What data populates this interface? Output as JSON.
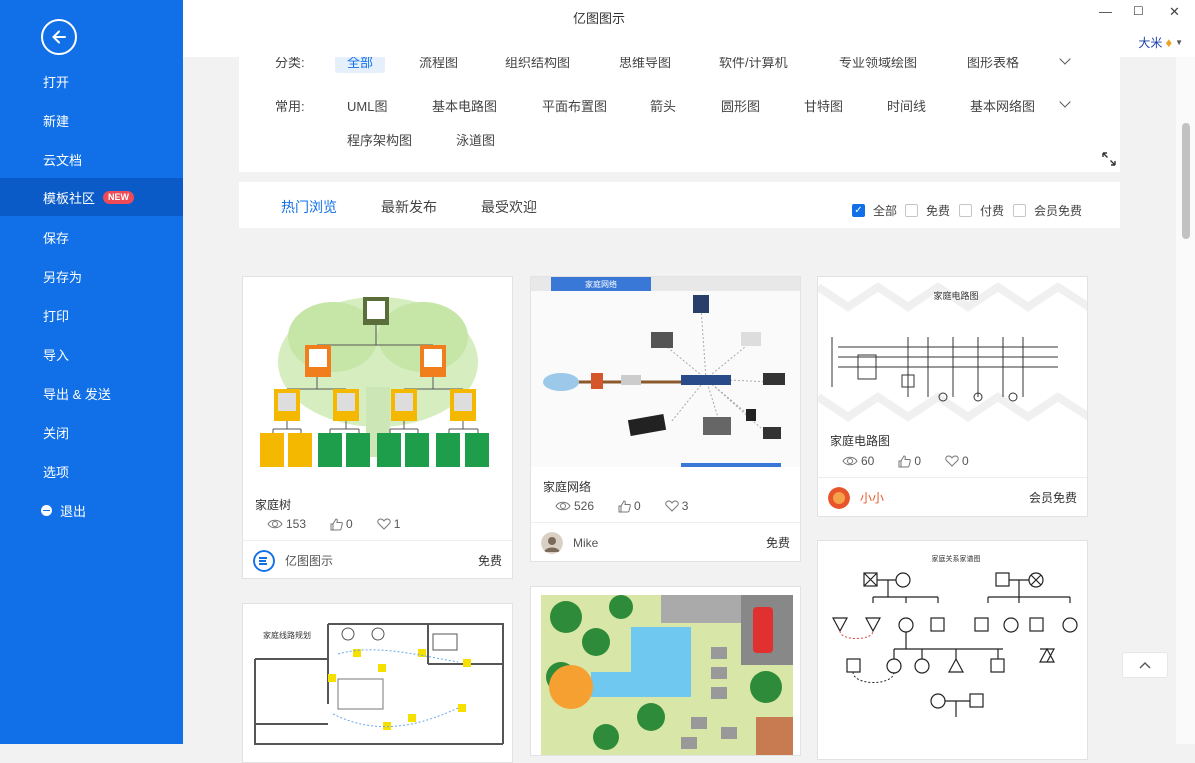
{
  "window": {
    "title": "亿图图示",
    "user": "大米",
    "minimize": "—",
    "maximize": "☐",
    "close": "✕"
  },
  "sidebar": {
    "items": [
      {
        "label": "打开"
      },
      {
        "label": "新建"
      },
      {
        "label": "云文档"
      },
      {
        "label": "模板社区",
        "badge": "NEW"
      },
      {
        "label": "保存"
      },
      {
        "label": "另存为"
      },
      {
        "label": "打印"
      },
      {
        "label": "导入"
      },
      {
        "label": "导出 & 发送"
      },
      {
        "label": "关闭"
      },
      {
        "label": "选项"
      },
      {
        "label": "退出"
      }
    ]
  },
  "filter": {
    "category_label": "分类:",
    "categories": [
      "全部",
      "流程图",
      "组织结构图",
      "思维导图",
      "软件/计算机",
      "专业领域绘图",
      "图形表格"
    ],
    "common_label": "常用:",
    "common": [
      "UML图",
      "基本电路图",
      "平面布置图",
      "箭头",
      "圆形图",
      "甘特图",
      "时间线",
      "基本网络图",
      "程序架构图",
      "泳道图"
    ]
  },
  "tabs": [
    "热门浏览",
    "最新发布",
    "最受欢迎"
  ],
  "price_filters": [
    {
      "label": "全部",
      "checked": true
    },
    {
      "label": "免费",
      "checked": false
    },
    {
      "label": "付费",
      "checked": false
    },
    {
      "label": "会员免费",
      "checked": false
    }
  ],
  "cards": [
    {
      "title": "家庭树",
      "views": "153",
      "likes": "0",
      "favorites": "1",
      "author": "亿图图示",
      "price": "免费"
    },
    {
      "title": "家庭网络",
      "views": "526",
      "likes": "0",
      "favorites": "3",
      "author": "Mike",
      "price": "免费",
      "thumb_label": "家庭网络"
    },
    {
      "title": "家庭电路图",
      "views": "60",
      "likes": "0",
      "favorites": "0",
      "author": "小小",
      "price": "会员免费",
      "thumb_label": "家庭电路图"
    },
    {
      "thumb_label": "家庭线路规划"
    },
    {},
    {
      "thumb_label": "家庭关系家谱图"
    }
  ],
  "colors": {
    "sidebar": "#1170e8",
    "sidebar_active": "#0a5bc8",
    "accent": "#1170e8",
    "badge": "#ef4a57",
    "author_orange": "#e8552a"
  }
}
